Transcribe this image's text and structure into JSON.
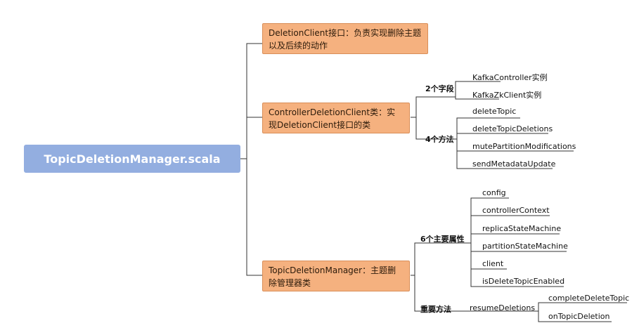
{
  "root": {
    "label": "TopicDeletionManager.scala"
  },
  "b1": {
    "text": "DeletionClient接口：负责实现删除主题以及后续的动作"
  },
  "b2": {
    "text": "ControllerDeletionClient类：实现DeletionClient接口的类",
    "fields_label": "2个字段",
    "fields": [
      "KafkaController实例",
      "KafkaZkClient实例"
    ],
    "methods_label": "4个方法",
    "methods": [
      "deleteTopic",
      "deleteTopicDeletions",
      "mutePartitionModifications",
      "sendMetadataUpdate"
    ]
  },
  "b3": {
    "text": "TopicDeletionManager：主题删除管理器类",
    "attrs_label": "6个主要属性",
    "attrs": [
      "config",
      "controllerContext",
      "replicaStateMachine",
      "partitionStateMachine",
      "client",
      "isDeleteTopicEnabled"
    ],
    "methods_label": "重要方法",
    "method": "resumeDeletions",
    "submethods": [
      "completeDeleteTopic",
      "onTopicDeletion"
    ]
  }
}
